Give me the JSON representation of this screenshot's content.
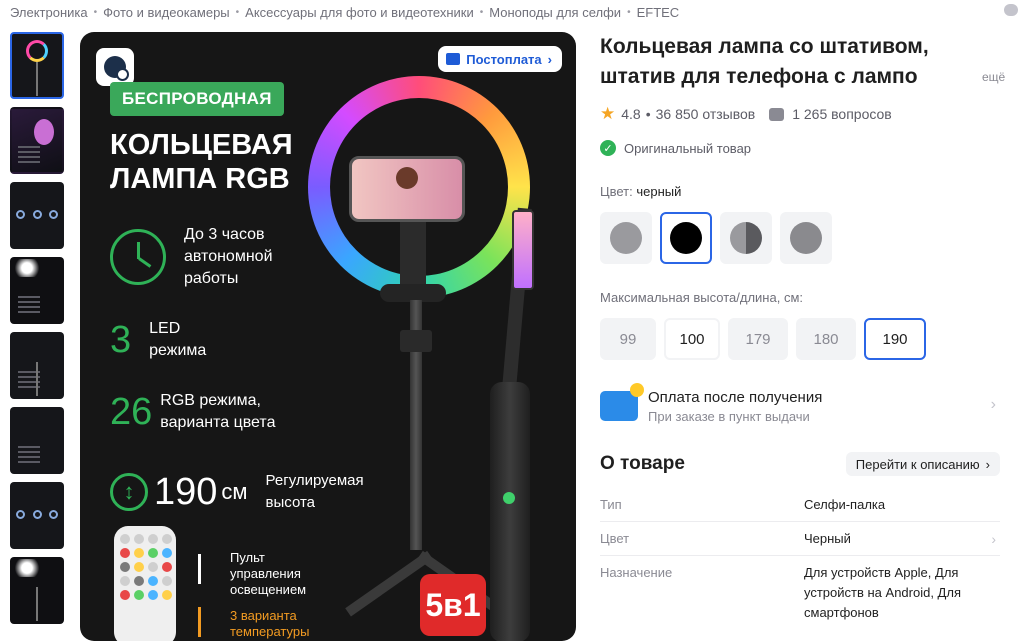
{
  "breadcrumbs": [
    "Электроника",
    "Фото и видеокамеры",
    "Аксессуары для фото и видеотехники",
    "Моноподы для селфи",
    "EFTEC"
  ],
  "hero": {
    "postpay_label": "Постоплата",
    "badge_wireless": "БЕСПРОВОДНАЯ",
    "title_line1": "КОЛЬЦЕВАЯ",
    "title_line2": "ЛАМПА RGB",
    "feature1": [
      "До 3 часов",
      "автономной",
      "работы"
    ],
    "feature2_num": "3",
    "feature2": [
      "LED",
      "режима"
    ],
    "feature3_num": "26",
    "feature3": [
      "RGB режима,",
      "варианта цвета"
    ],
    "feature4_num": "190",
    "feature4_unit": "см",
    "feature4": [
      "Регулируемая",
      "высота"
    ],
    "remote_text": [
      "Пульт",
      "управления",
      "освещением"
    ],
    "remote_text2": [
      "3 варианта",
      "температуры"
    ],
    "badge_5v1": "5в1"
  },
  "product": {
    "title": "Кольцевая лампа со штативом, штатив для телефона с лампо",
    "title_more": "ещё",
    "rating": "4.8",
    "reviews": "36 850 отзывов",
    "questions": "1 265 вопросов",
    "original": "Оригинальный товар",
    "color_label": "Цвет:",
    "color_value": "черный",
    "color_swatches": [
      "#9a9a9e",
      "#000000",
      "#8e8e92",
      "#8a8a8e"
    ],
    "size_label": "Максимальная высота/длина, см:",
    "sizes": [
      "99",
      "100",
      "179",
      "180",
      "190"
    ],
    "pay_title": "Оплата после получения",
    "pay_sub": "При заказе в пункт выдачи",
    "about_title": "О товаре",
    "about_link": "Перейти к описанию",
    "specs": [
      {
        "key": "Тип",
        "value": "Селфи-палка"
      },
      {
        "key": "Цвет",
        "value": "Черный"
      },
      {
        "key": "Назначение",
        "value": "Для устройств Apple, Для устройств на Android, Для смартфонов"
      }
    ]
  },
  "colors": {
    "accent_blue": "#2b66e6",
    "brand_green": "#2fb257",
    "badge_red": "#e02a2a",
    "star": "#f5a524"
  }
}
